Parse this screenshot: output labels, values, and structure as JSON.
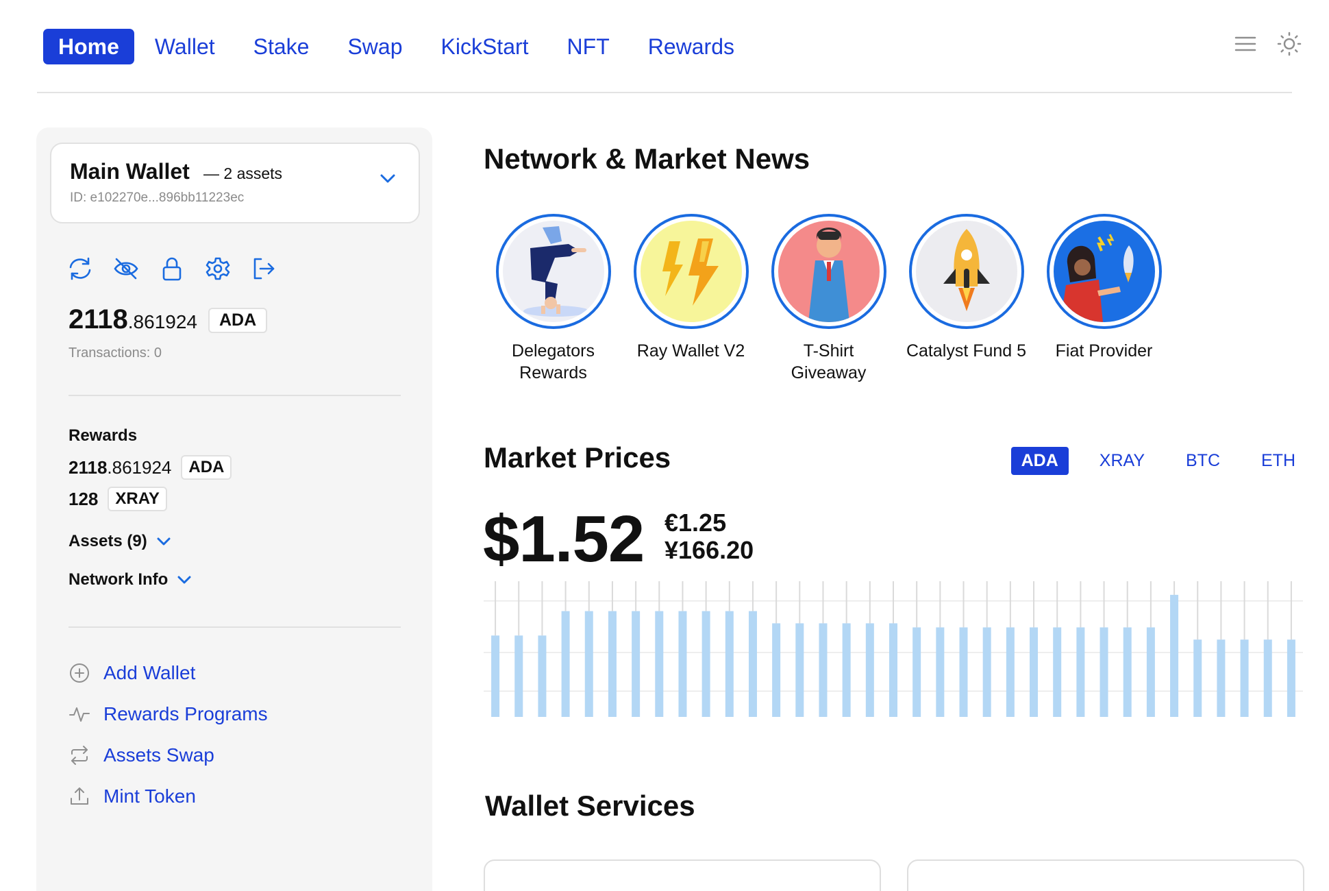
{
  "nav": {
    "items": [
      {
        "label": "Home",
        "active": true
      },
      {
        "label": "Wallet"
      },
      {
        "label": "Stake"
      },
      {
        "label": "Swap"
      },
      {
        "label": "KickStart"
      },
      {
        "label": "NFT"
      },
      {
        "label": "Rewards"
      }
    ],
    "icons": [
      "menu-icon",
      "sun-icon"
    ]
  },
  "colors": {
    "accent": "#1a3ed8",
    "ring": "#1a6be0",
    "bar": "#b3d7f5"
  },
  "wallet": {
    "name": "Main Wallet",
    "assets": "— 2 assets",
    "id": "ID: e102270e...896bb11223ec",
    "actions": [
      "refresh-icon",
      "eye-off-icon",
      "lock-icon",
      "settings-icon",
      "logout-icon"
    ],
    "balance_int": "2118",
    "balance_dec": ".861924",
    "balance_unit": "ADA",
    "transactions": "Transactions: 0"
  },
  "rewards": {
    "title": "Rewards",
    "rows": [
      {
        "int": "2118",
        "dec": ".861924",
        "unit": "ADA"
      },
      {
        "int": "128",
        "dec": "",
        "unit": "XRAY"
      }
    ]
  },
  "collapsibles": {
    "assets": "Assets (9)",
    "network": "Network Info"
  },
  "menu": [
    {
      "label": "Add Wallet",
      "icon": "plus-circle-icon"
    },
    {
      "label": "Rewards Programs",
      "icon": "activity-icon"
    },
    {
      "label": "Assets Swap",
      "icon": "swap-icon"
    },
    {
      "label": "Mint Token",
      "icon": "upload-icon"
    }
  ],
  "news": {
    "title": "Network & Market News",
    "stories": [
      {
        "label": "Delegators Rewards"
      },
      {
        "label": "Ray Wallet V2"
      },
      {
        "label": "T-Shirt Giveaway"
      },
      {
        "label": "Catalyst Fund 5"
      },
      {
        "label": "Fiat Provider"
      }
    ]
  },
  "market": {
    "title": "Market Prices",
    "tabs": [
      {
        "label": "ADA",
        "active": true
      },
      {
        "label": "XRAY"
      },
      {
        "label": "BTC"
      },
      {
        "label": "ETH"
      }
    ],
    "price_usd": "$1.52",
    "price_eur": "€1.25",
    "price_jpy": "¥166.20"
  },
  "chart_data": {
    "type": "bar",
    "values": [
      1.5,
      1.5,
      1.5,
      1.56,
      1.56,
      1.56,
      1.56,
      1.56,
      1.56,
      1.56,
      1.56,
      1.56,
      1.53,
      1.53,
      1.53,
      1.53,
      1.53,
      1.53,
      1.52,
      1.52,
      1.52,
      1.52,
      1.52,
      1.52,
      1.52,
      1.52,
      1.52,
      1.52,
      1.52,
      1.6,
      1.49,
      1.49,
      1.49,
      1.49,
      1.49
    ],
    "title": "",
    "xlabel": "",
    "ylabel": "",
    "grid": true
  },
  "services": {
    "title": "Wallet Services"
  }
}
